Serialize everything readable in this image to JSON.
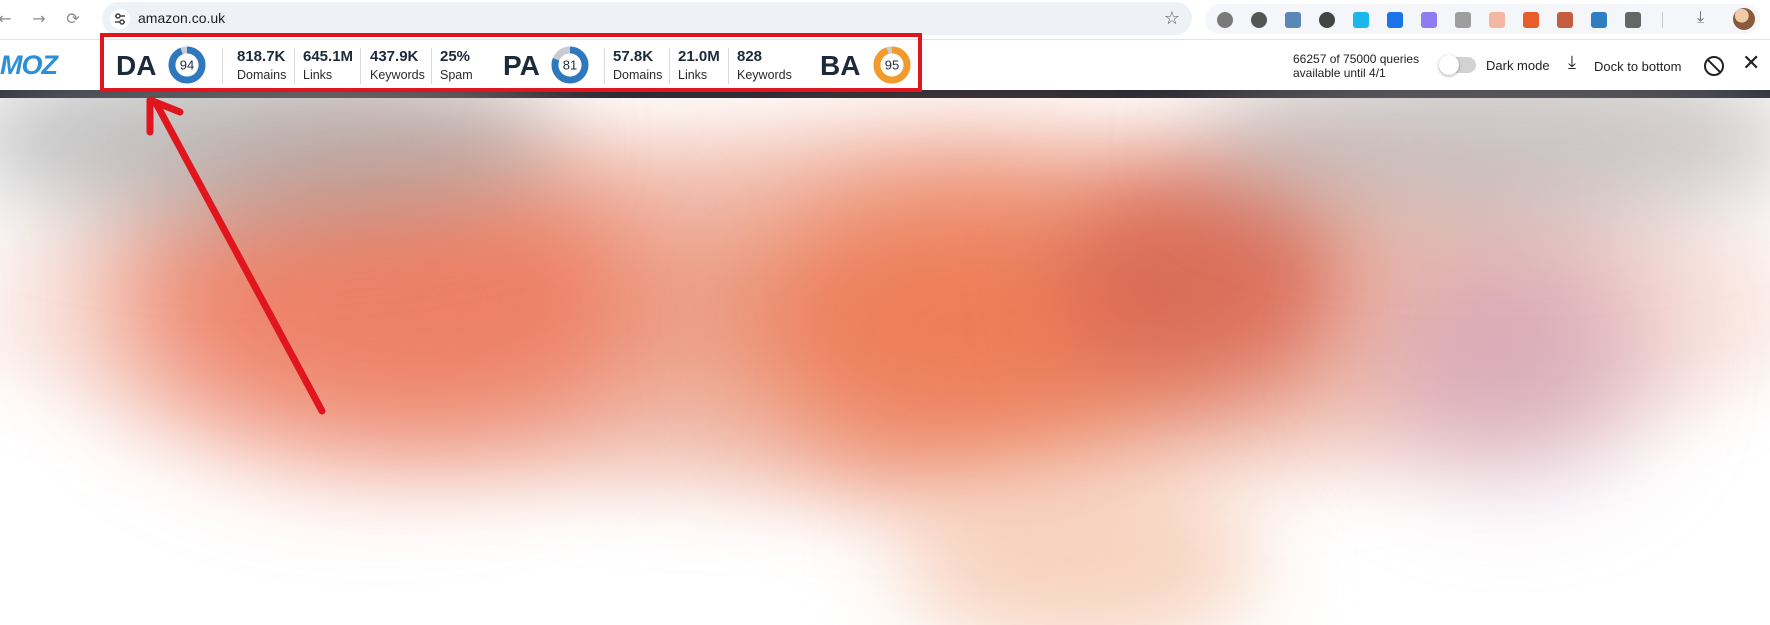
{
  "browser": {
    "url": "amazon.co.uk",
    "nav": {
      "back_icon": "←",
      "forward_icon": "→",
      "reload_icon": "⟳"
    },
    "extensions": [
      {
        "name": "k-ext-icon",
        "color": "#7a7a7a"
      },
      {
        "name": "sun-ext-icon",
        "color": "#555555"
      },
      {
        "name": "score-94-ext-icon",
        "color": "#5b87b8"
      },
      {
        "name": "grammarly-ext-icon",
        "color": "#444444"
      },
      {
        "name": "vimeo-ext-icon",
        "color": "#19b7ea"
      },
      {
        "name": "onepassword-ext-icon",
        "color": "#1a73e8"
      },
      {
        "name": "check-ext-icon",
        "color": "#8e7cf0"
      },
      {
        "name": "camera-ext-icon",
        "color": "#9e9e9e"
      },
      {
        "name": "edit-ext-icon",
        "color": "#f3b6a0"
      },
      {
        "name": "record-ext-icon",
        "color": "#e85d2a"
      },
      {
        "name": "pen-ext-icon",
        "color": "#c45c3e"
      },
      {
        "name": "s-ext-icon",
        "color": "#2f7ec2"
      },
      {
        "name": "puzzle-ext-icon",
        "color": "#666666"
      }
    ]
  },
  "mozbar": {
    "logo": "MOZ",
    "da": {
      "label": "DA",
      "score": "94",
      "fraction": 0.94,
      "color": "#2e79be"
    },
    "da_stats": [
      {
        "value": "818.7K",
        "label": "Domains"
      },
      {
        "value": "645.1M",
        "label": "Links"
      },
      {
        "value": "437.9K",
        "label": "Keywords"
      },
      {
        "value": "25%",
        "label": "Spam"
      }
    ],
    "pa": {
      "label": "PA",
      "score": "81",
      "fraction": 0.81,
      "color": "#2e79be"
    },
    "pa_stats": [
      {
        "value": "57.8K",
        "label": "Domains"
      },
      {
        "value": "21.0M",
        "label": "Links"
      },
      {
        "value": "828",
        "label": "Keywords"
      }
    ],
    "ba": {
      "label": "BA",
      "score": "95",
      "fraction": 0.95,
      "color": "#f09b2c"
    },
    "quota_line1": "66257 of 75000 queries",
    "quota_line2": "available until 4/1",
    "dark_mode_label": "Dark mode",
    "dark_mode_on": false,
    "dock_label": "Dock to bottom"
  },
  "colors": {
    "highlight": "#e0151e",
    "arrow": "#e0151e",
    "ring_track": "#c8ccd2"
  }
}
